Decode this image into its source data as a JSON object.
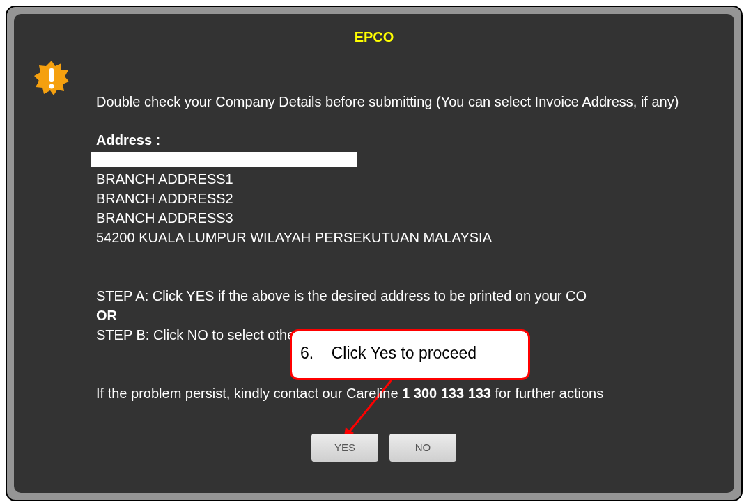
{
  "dialog": {
    "title": "EPCO",
    "message": "Double check your Company Details before submitting (You can select Invoice Address, if any)",
    "address_label": "Address :",
    "address_lines": [
      "BRANCH ADDRESS1",
      "BRANCH ADDRESS2",
      "BRANCH ADDRESS3",
      "54200 KUALA LUMPUR WILAYAH PERSEKUTUAN MALAYSIA"
    ],
    "steps": [
      {
        "text": "STEP A: Click YES if the above is the desired address to be printed on your CO",
        "kind": "plain"
      },
      {
        "text": "OR",
        "kind": "bold"
      },
      {
        "text": "STEP B: Click NO to select othe",
        "kind": "plain"
      }
    ],
    "careline": "If the problem persist, kindly contact our Careline **1 300 133 133** for further actions",
    "buttons": [
      "YES",
      "NO"
    ]
  },
  "callout": {
    "text": "6.    Click Yes to proceed"
  }
}
